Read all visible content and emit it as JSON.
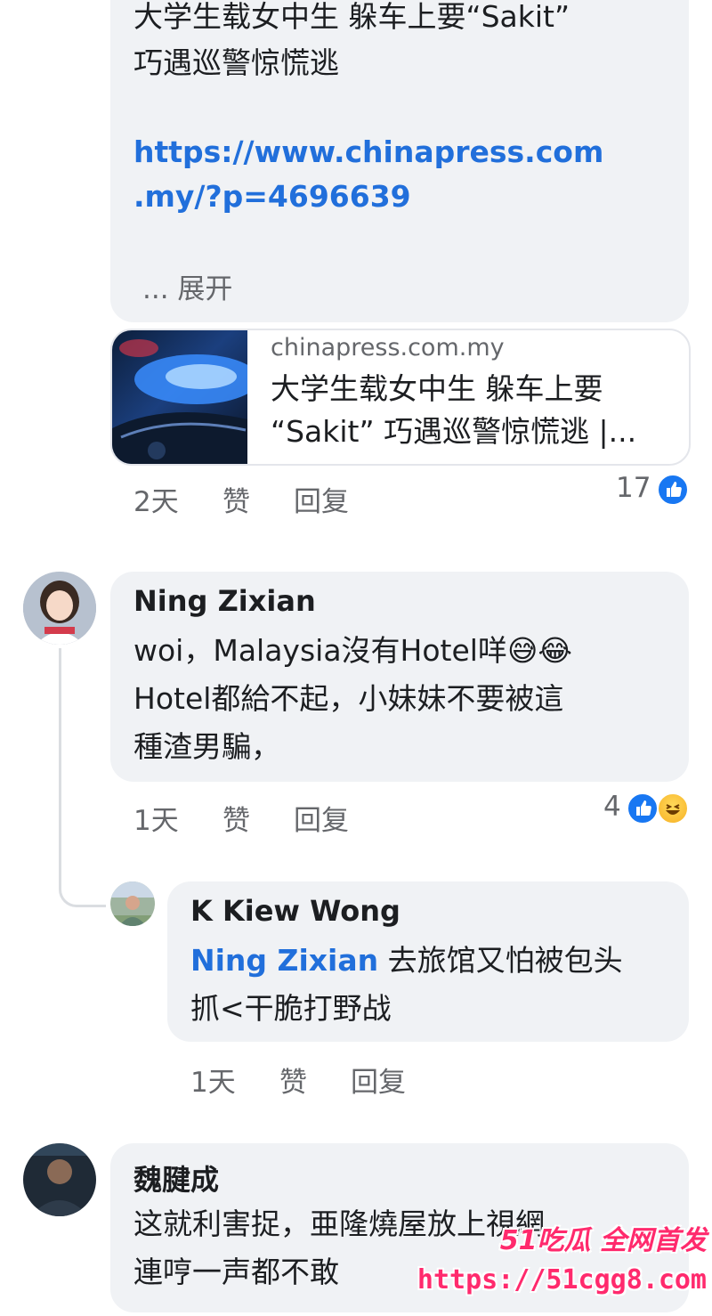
{
  "post": {
    "text_line1": "大学生载女中生 躲车上要“Sakit”",
    "text_line2": "巧遇巡警惊慌逃",
    "link_line1": "https://www.chinapress.com",
    "link_line2": ".my/?p=4696639",
    "see_more": "... 展开",
    "card_domain": "chinapress.com.my",
    "card_title": "大学生载女中生 躲车上要 “Sakit” 巧遇巡警惊慌逃 |...",
    "time": "2天",
    "like_label": "赞",
    "reply_label": "回复",
    "reaction_count": "17"
  },
  "comments": [
    {
      "author": "Ning Zixian",
      "line1": "woi，Malaysia沒有Hotel咩😅😂",
      "line2": "Hotel都給不起，小妹妹不要被這",
      "line3": "種渣男騙，",
      "time": "1天",
      "like_label": "赞",
      "reply_label": "回复",
      "reaction_count": "4"
    },
    {
      "author": "K Kiew Wong",
      "mention": "Ning Zixian",
      "line1_rest": " 去旅馆又怕被包头",
      "line2": "抓<干脆打野战",
      "time": "1天",
      "like_label": "赞",
      "reply_label": "回复"
    },
    {
      "author": "魏腱成",
      "line1": "这就利害捉，亜隆燒屋放上視網，",
      "line2": "連哼一声都不敢"
    }
  ],
  "watermark": {
    "brand": "51吃瓜 全网首发",
    "url": "https://51cgg8.com"
  },
  "colors": {
    "bubble": "#f0f2f5",
    "link": "#216fdb",
    "meta": "#65676b",
    "like": "#1877f2",
    "watermark": "#ff2a6d"
  }
}
